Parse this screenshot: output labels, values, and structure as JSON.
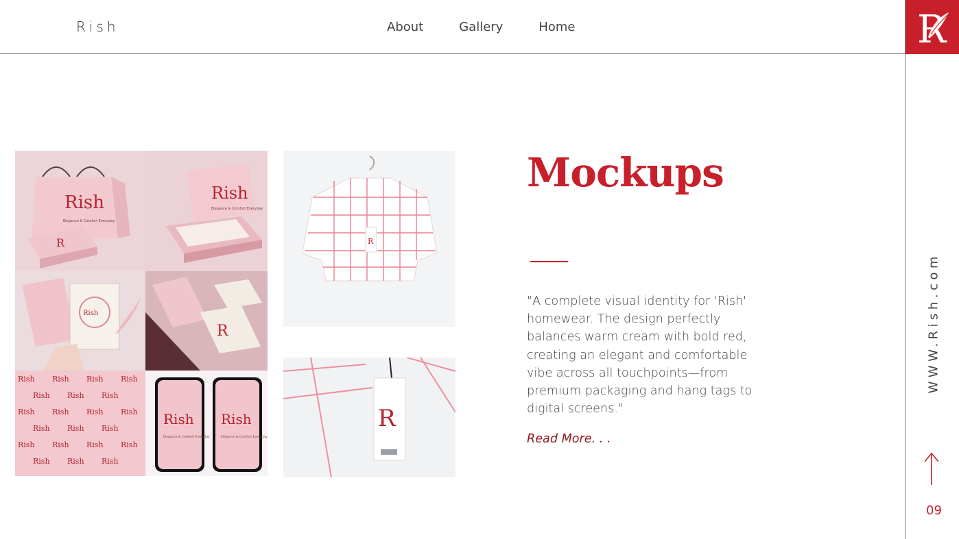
{
  "header": {
    "brand": "Rish",
    "nav": [
      "About",
      "Gallery",
      "Home"
    ]
  },
  "logo": {
    "letter": "R",
    "background": "#c8202b"
  },
  "main": {
    "title": "Mockups",
    "description": "\"A complete visual identity for 'Rish' homewear. The design perfectly balances warm cream with bold red, creating an elegant and comfortable vibe across all touchpoints—from premium packaging and hang tags to digital screens.\"",
    "read_more": "Read More. . ."
  },
  "sidebar": {
    "website": "WWW.Rish.com",
    "page_number": "09"
  },
  "mockup_text": {
    "brand": "Rish",
    "tagline": "Elegance & Comfort Everyday"
  },
  "colors": {
    "accent": "#c8202b",
    "dark_accent": "#8e1b22",
    "pink": "#f1cdd2"
  }
}
